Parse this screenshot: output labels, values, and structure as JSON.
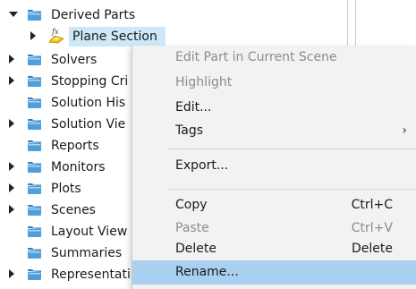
{
  "tree": {
    "items": [
      {
        "label": "Derived Parts",
        "expander": "down",
        "icon": "folder-icon"
      },
      {
        "label": "Plane Section",
        "expander": "right",
        "icon": "plane-section-icon",
        "selected": true
      },
      {
        "label": "Solvers",
        "expander": "right",
        "icon": "folder-icon"
      },
      {
        "label": "Stopping Cri",
        "expander": "right",
        "icon": "folder-icon"
      },
      {
        "label": "Solution His",
        "expander": "none",
        "icon": "folder-icon"
      },
      {
        "label": "Solution Vie",
        "expander": "right",
        "icon": "folder-icon"
      },
      {
        "label": "Reports",
        "expander": "none",
        "icon": "folder-icon"
      },
      {
        "label": "Monitors",
        "expander": "right",
        "icon": "folder-icon"
      },
      {
        "label": "Plots",
        "expander": "right",
        "icon": "folder-icon"
      },
      {
        "label": "Scenes",
        "expander": "right",
        "icon": "folder-icon"
      },
      {
        "label": "Layout View",
        "expander": "none",
        "icon": "folder-icon"
      },
      {
        "label": "Summaries",
        "expander": "none",
        "icon": "folder-icon"
      },
      {
        "label": "Representati",
        "expander": "right",
        "icon": "folder-icon"
      }
    ]
  },
  "context_menu": {
    "items": [
      {
        "label": "Edit Part in Current Scene",
        "shortcut": "",
        "disabled": true
      },
      {
        "label": "Highlight",
        "shortcut": "",
        "disabled": true
      },
      {
        "label": "Edit...",
        "shortcut": ""
      },
      {
        "label": "Tags",
        "shortcut": "",
        "submenu": true,
        "submenu_glyph": "›"
      },
      {
        "separator": true
      },
      {
        "label": "Export...",
        "shortcut": ""
      },
      {
        "separator": true
      },
      {
        "label": "Copy",
        "shortcut": "Ctrl+C"
      },
      {
        "label": "Paste",
        "shortcut": "Ctrl+V",
        "disabled": true
      },
      {
        "label": "Delete",
        "shortcut": "Delete"
      },
      {
        "label": "Rename...",
        "shortcut": "",
        "highlighted": true
      }
    ]
  },
  "colors": {
    "folder": "#4f9fdc",
    "folder_dark": "#2f7fc0",
    "selection": "#cde8f7",
    "menu_highlight": "#a9d0f0"
  }
}
